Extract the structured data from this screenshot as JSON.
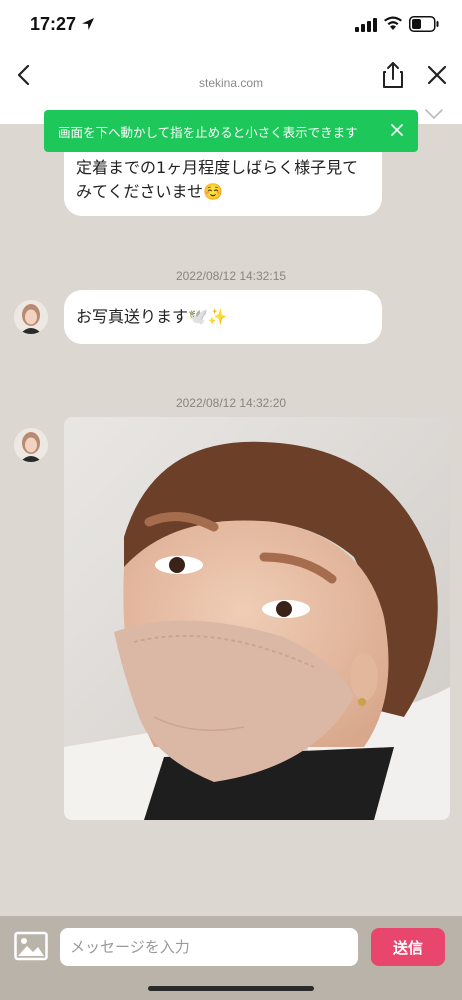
{
  "status_bar": {
    "time": "17:27",
    "icons": [
      "location-arrow-icon",
      "cellular-signal-icon",
      "wifi-icon",
      "battery-icon"
    ]
  },
  "nav": {
    "url": "stekina.com",
    "icons": [
      "back-chevron-icon",
      "share-icon",
      "close-icon",
      "chevron-down-icon"
    ]
  },
  "toast": {
    "text": "画面を下へ動かして指を止めると小さく表示できます",
    "color": "#1ec75a"
  },
  "messages": [
    {
      "text": "定着までの1ヶ月程度しばらく様子見てみてくださいませ☺️"
    },
    {
      "timestamp": "2022/08/12 14:32:15",
      "text": "お写真送ります🕊️✨"
    },
    {
      "timestamp": "2022/08/12 14:32:20",
      "image": "photo-of-woman-with-mask"
    }
  ],
  "composer": {
    "placeholder": "メッセージを入力",
    "send_label": "送信",
    "send_color": "#e8466c"
  },
  "colors": {
    "chat_background": "#dcd7d0",
    "input_bar": "#b9b3aa"
  }
}
